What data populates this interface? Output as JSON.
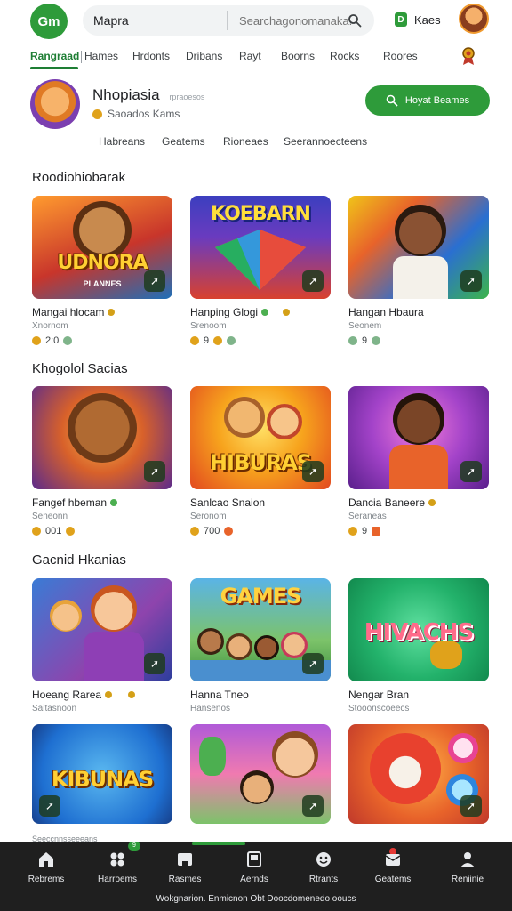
{
  "header": {
    "logo_text": "Gm",
    "app_name": "Mapra",
    "search_placeholder": "Searchagonomanaka.",
    "coins_label": "Kaes",
    "coin_icon_text": "D"
  },
  "tabs": [
    "Rangraad",
    "Hames",
    "Hrdonts",
    "Dribans",
    "Rayt",
    "Boorns",
    "Rocks",
    "Roores"
  ],
  "profile": {
    "name": "Nhopiasia",
    "name_tag": "rpraoesos",
    "subtitle": "Saoados Kams",
    "follow_label": "Hoyat Beames",
    "subtabs": [
      "Habreans",
      "Geatems",
      "Rioneaes",
      "Seerannoecteens"
    ]
  },
  "sections": [
    {
      "title": "Roodiohiobarak",
      "cards": [
        {
          "thumb_title": "UDNORA",
          "thumb_sub": "PLANNES",
          "name": "Mangai hlocam",
          "sub": "Xnornom",
          "stat": "2:0"
        },
        {
          "thumb_title": "KOEBARN",
          "thumb_sub": "",
          "name": "Hanping Glogi",
          "sub": "Srenoom",
          "stat": "9"
        },
        {
          "thumb_title": "",
          "thumb_sub": "",
          "name": "Hangan Hbaura",
          "sub": "Seonem",
          "stat": "9"
        }
      ]
    },
    {
      "title": "Khogolol Sacias",
      "cards": [
        {
          "thumb_title": "",
          "thumb_sub": "",
          "name": "Fangef hbeman",
          "sub": "Seneonn",
          "stat": "001"
        },
        {
          "thumb_title": "HIBURAS",
          "thumb_sub": "",
          "name": "Sanlcao Snaion",
          "sub": "Seronom",
          "stat": "700"
        },
        {
          "thumb_title": "",
          "thumb_sub": "",
          "name": "Dancia Baneere",
          "sub": "Seraneas",
          "stat": "9"
        }
      ]
    },
    {
      "title": "Gacnid Hkanias",
      "cards": [
        {
          "thumb_title": "",
          "thumb_sub": "",
          "name": "Hoeang Rarea",
          "sub": "Saitasnoon",
          "stat": ""
        },
        {
          "thumb_title": "GAMES",
          "thumb_sub": "",
          "name": "Hanna Tneo",
          "sub": "Hansenos",
          "stat": ""
        },
        {
          "thumb_title": "HIVACHS",
          "thumb_sub": "",
          "name": "Nengar Bran",
          "sub": "Stooonscoeecs",
          "stat": ""
        }
      ]
    },
    {
      "title": "",
      "cards": [
        {
          "thumb_title": "KIBUNAS",
          "thumb_sub": "",
          "name": "",
          "sub": "",
          "stat": ""
        },
        {
          "thumb_title": "",
          "thumb_sub": "",
          "name": "",
          "sub": "",
          "stat": ""
        },
        {
          "thumb_title": "",
          "thumb_sub": "",
          "name": "",
          "sub": "",
          "stat": ""
        }
      ]
    }
  ],
  "partial_row_text": "Seeccnnsseeeans",
  "bottom_nav": [
    {
      "label": "Rebrems",
      "icon": "home-icon"
    },
    {
      "label": "Harroems",
      "icon": "games-icon"
    },
    {
      "label": "Rasmes",
      "icon": "gift-icon"
    },
    {
      "label": "Aernds",
      "icon": "tablet-icon"
    },
    {
      "label": "Rtrants",
      "icon": "face-icon"
    },
    {
      "label": "Geatems",
      "icon": "mail-icon"
    },
    {
      "label": "Reniinie",
      "icon": "profile-icon"
    }
  ],
  "nav_badge": "9",
  "footer": "Wokgnarion. Enmicnon  Obt Doocdomenedo ooucs",
  "colors": {
    "accent": "#2e9b3a",
    "nav_bg": "#1f1f1f"
  }
}
